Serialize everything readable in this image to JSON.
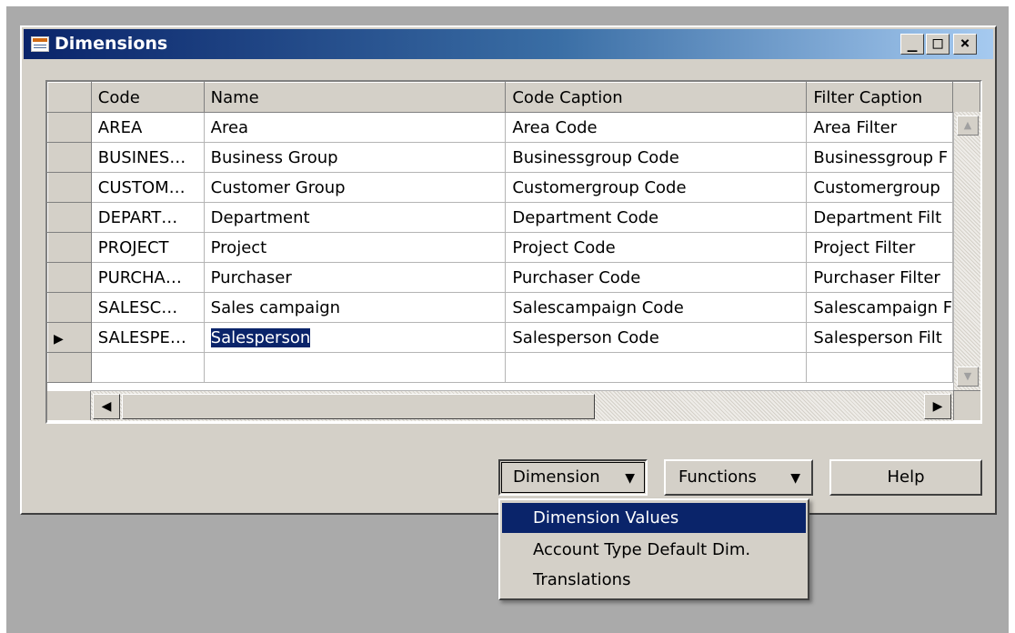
{
  "window": {
    "title": "Dimensions",
    "controls": {
      "minimize": "_",
      "maximize": "□",
      "close": "×"
    }
  },
  "grid": {
    "columns": [
      "Code",
      "Name",
      "Code Caption",
      "Filter Caption"
    ],
    "rows": [
      [
        "AREA",
        "Area",
        "Area Code",
        "Area Filter"
      ],
      [
        "BUSINES…",
        "Business Group",
        "Businessgroup Code",
        "Businessgroup F"
      ],
      [
        "CUSTOM…",
        "Customer Group",
        "Customergroup Code",
        "Customergroup"
      ],
      [
        "DEPART…",
        "Department",
        "Department Code",
        "Department Filt"
      ],
      [
        "PROJECT",
        "Project",
        "Project Code",
        "Project Filter"
      ],
      [
        "PURCHA…",
        "Purchaser",
        "Purchaser Code",
        "Purchaser Filter"
      ],
      [
        "SALESC…",
        "Sales campaign",
        "Salescampaign Code",
        "Salescampaign F"
      ],
      [
        "SALESPE…",
        "Salesperson",
        "Salesperson Code",
        "Salesperson Filt"
      ]
    ],
    "current_row_marker": "▶"
  },
  "buttons": {
    "dimension": "Dimension",
    "functions": "Functions",
    "help": "Help"
  },
  "dimension_menu": {
    "items": [
      "Dimension Values",
      "Account Type Default Dim.",
      "Translations"
    ],
    "active": "Dimension Values"
  }
}
